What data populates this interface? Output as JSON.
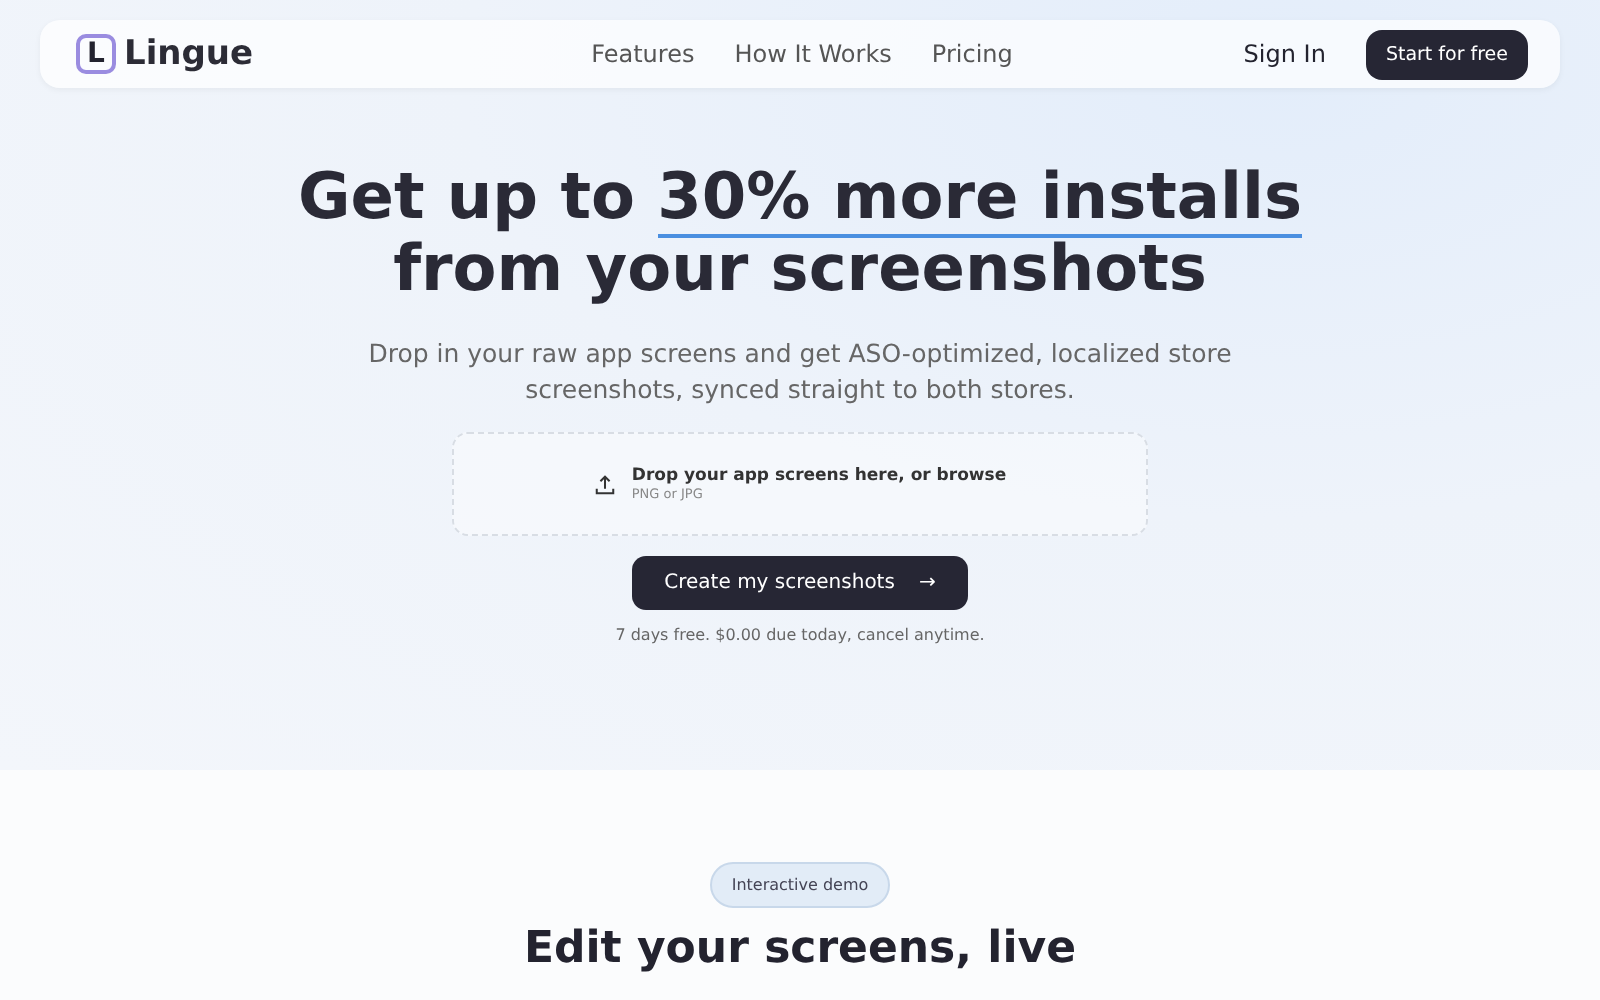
{
  "nav": {
    "logo_letter": "L",
    "brand": "Lingue",
    "links": [
      "Features",
      "How It Works",
      "Pricing"
    ],
    "sign_in": "Sign In",
    "cta": "Start for free"
  },
  "hero": {
    "headline": {
      "before": "Get up to ",
      "highlight": "30% more installs",
      "after": "from your screenshots"
    },
    "subtitle": "Drop in your raw app screens and get ASO-optimized, localized store screenshots, synced straight to both stores.",
    "dropzone": {
      "title": "Drop your app screens here, or browse",
      "hint": "PNG or JPG"
    },
    "button": "Create my screenshots",
    "button_arrow": "→",
    "note": "7 days free. $0.00 due today, cancel anytime."
  },
  "demo": {
    "badge": "Interactive demo",
    "heading": "Edit your screens, live"
  }
}
